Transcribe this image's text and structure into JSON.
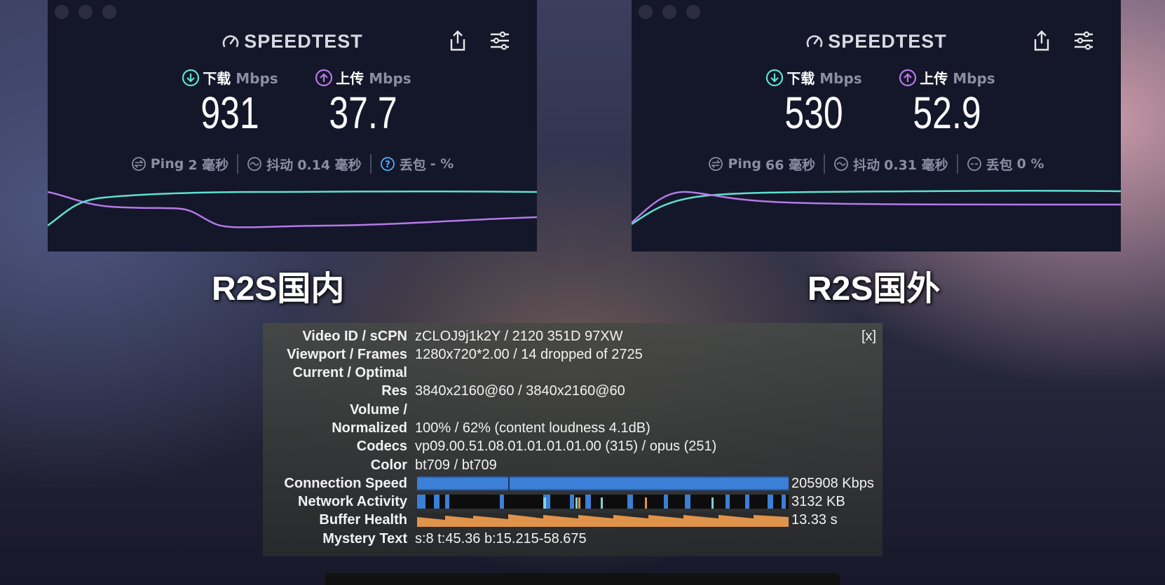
{
  "speedtests": [
    {
      "brand": "SPEEDTEST",
      "download_label": "下载",
      "upload_label": "上传",
      "unit": "Mbps",
      "download": "931",
      "upload": "37.7",
      "ping_label": "Ping",
      "ping": "2 毫秒",
      "jitter_label": "抖动",
      "jitter": "0.14 毫秒",
      "loss_label": "丢包",
      "loss": "- %",
      "caption": "R2S国内"
    },
    {
      "brand": "SPEEDTEST",
      "download_label": "下载",
      "upload_label": "上传",
      "unit": "Mbps",
      "download": "530",
      "upload": "52.9",
      "ping_label": "Ping",
      "ping": "66 毫秒",
      "jitter_label": "抖动",
      "jitter": "0.31 毫秒",
      "loss_label": "丢包",
      "loss": "0 %",
      "caption": "R2S国外"
    }
  ],
  "colors": {
    "download": "#5fe0cf",
    "upload": "#b47ae8",
    "window_bg": "#141629",
    "connection_bar": "#2f6ec2",
    "buffer_bar": "#e0934a"
  },
  "stats_for_nerds": {
    "close": "[x]",
    "rows": [
      {
        "label": "Video ID / sCPN",
        "value": "zCLOJ9j1k2Y / 2120 351D 97XW"
      },
      {
        "label": "Viewport / Frames",
        "value": "1280x720*2.00 / 14 dropped of 2725"
      },
      {
        "label": "Current / Optimal",
        "value": ""
      },
      {
        "label": "Res",
        "value": "3840x2160@60 / 3840x2160@60"
      },
      {
        "label": "Volume /",
        "value": ""
      },
      {
        "label": "Normalized",
        "value": "100% / 62% (content loudness 4.1dB)"
      },
      {
        "label": "Codecs",
        "value": "vp09.00.51.08.01.01.01.01.00 (315) / opus (251)"
      },
      {
        "label": "Color",
        "value": "bt709 / bt709"
      },
      {
        "label": "Connection Speed",
        "value": "205908 Kbps"
      },
      {
        "label": "Network Activity",
        "value": "3132 KB"
      },
      {
        "label": "Buffer Health",
        "value": "13.33 s"
      },
      {
        "label": "Mystery Text",
        "value": "s:8 t:45.36 b:15.215-58.675"
      }
    ]
  }
}
